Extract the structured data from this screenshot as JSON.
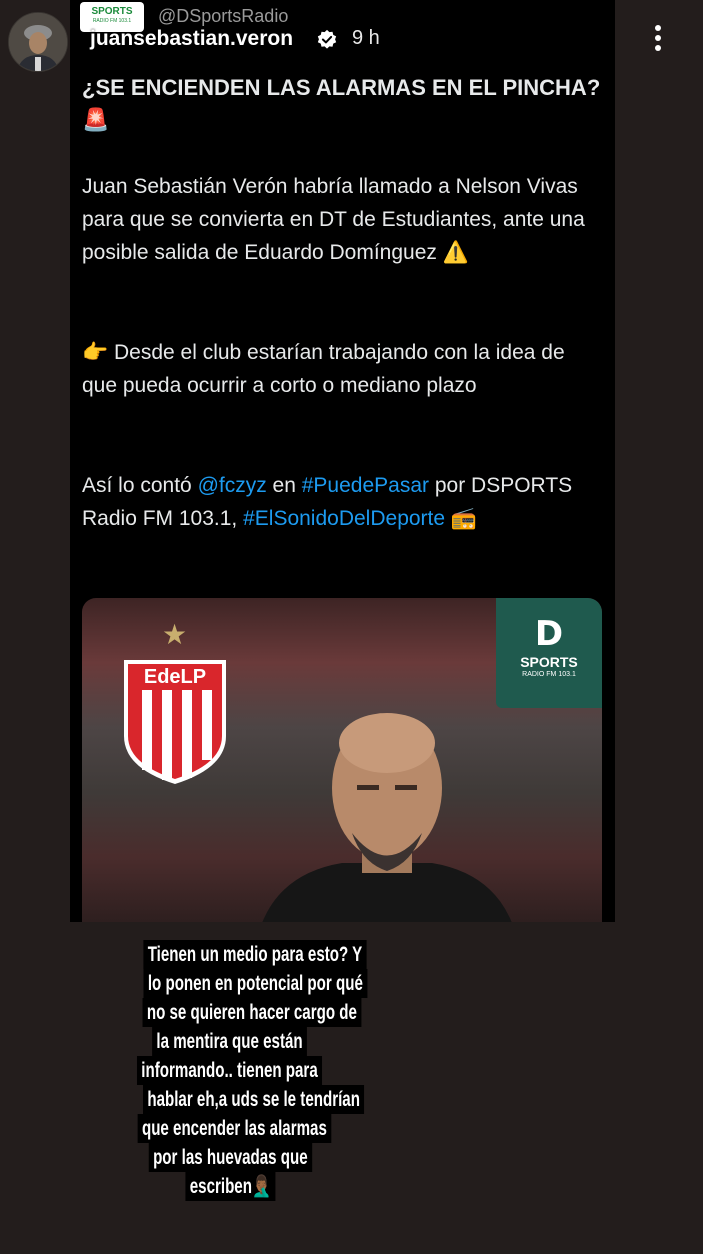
{
  "story": {
    "username": "juansebastian.veron",
    "time": "9 h",
    "menu_icon": "more-vertical-icon"
  },
  "tweet": {
    "source_logo_line1": "SPORTS",
    "source_logo_line2": "RADIO FM 103.1",
    "handle": "@DSportsRadio",
    "title": "¿SE ENCIENDEN LAS ALARMAS EN EL PINCHA? 🚨",
    "para1": "Juan Sebastián Verón habría llamado a Nelson Vivas para que se convierta en DT de Estudiantes, ante una posible salida de Eduardo Domínguez ⚠️",
    "para2": "👉 Desde el club estarían trabajando con la idea de que pueda ocurrir a corto o mediano plazo",
    "para3_a": "Así lo contó ",
    "para3_mention": "@fczyz",
    "para3_b": " en ",
    "para3_tag1": "#PuedePasar",
    "para3_c": " por DSPORTS Radio FM 103.1, ",
    "para3_tag2": "#ElSonidoDelDeporte",
    "para3_emoji": "📻"
  },
  "image": {
    "shield_text": "EdeLP",
    "badge_letter": "D",
    "badge_name": "SPORTS",
    "badge_sub": "RADIO FM 103.1"
  },
  "comment": {
    "lines": [
      "Tienen un medio para esto? Y",
      "lo ponen en potencial por qué",
      "no se quieren hacer cargo de",
      "la mentira que están",
      "informando.. tienen para",
      "hablar eh,a uds se le tendrían",
      "que encender las alarmas",
      "por las huevadas que",
      "escriben🤦🏾‍♂️"
    ]
  },
  "colors": {
    "background": "#231d1c",
    "tweet_bg": "#000000",
    "link": "#1d9bf0",
    "text": "#e7e9ea"
  }
}
